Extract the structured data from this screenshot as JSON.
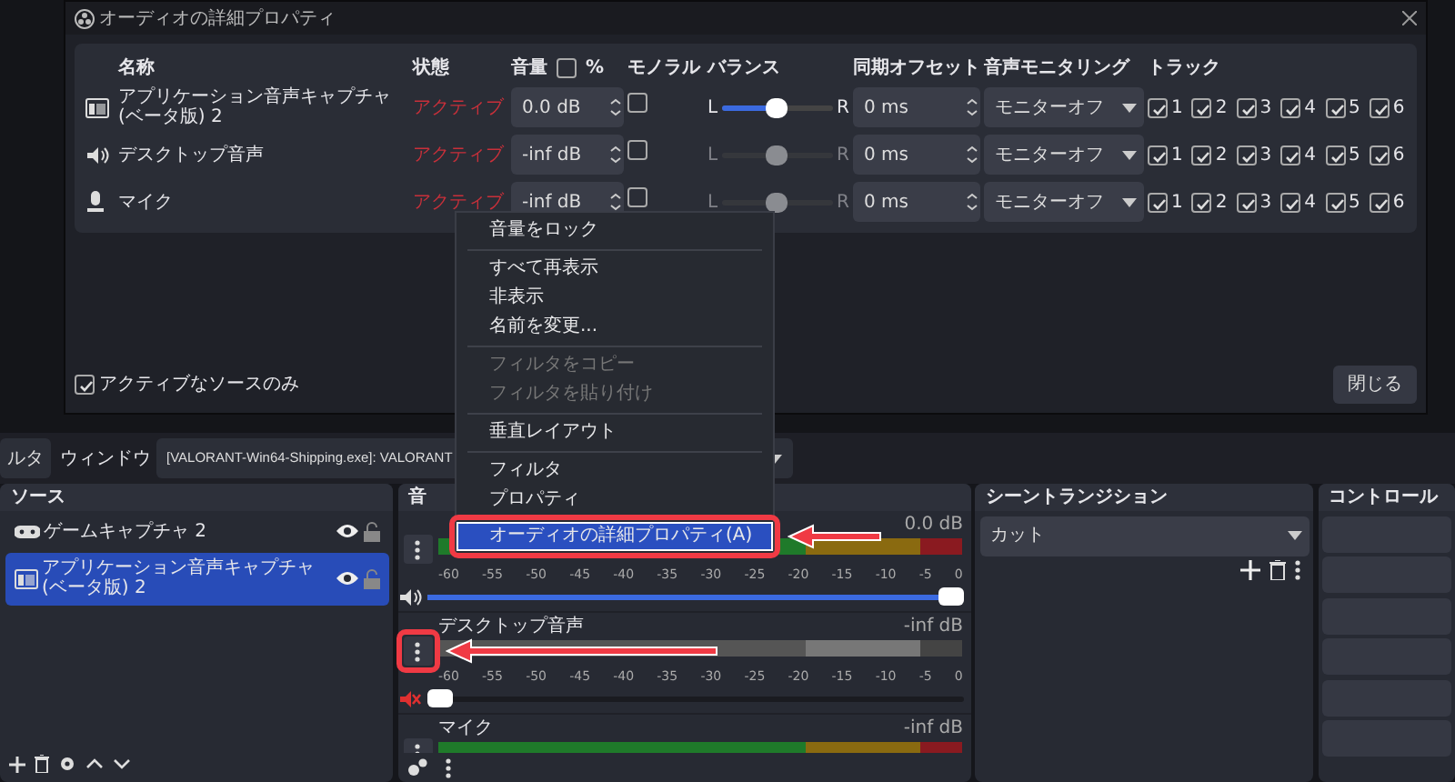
{
  "dialog": {
    "title": "オーディオの詳細プロパティ",
    "columns": [
      "名称",
      "状態",
      "音量",
      "モノラル",
      "バランス",
      "同期オフセット",
      "音声モニタリング",
      "トラック"
    ],
    "percent": {
      "label": "%",
      "checked": false
    },
    "rows": [
      {
        "kind": "app",
        "name": "アプリケーション音声キャプチャ (ベータ版) 2",
        "status": "アクティブ",
        "volume": "0.0 dB",
        "mono": false,
        "left": "L",
        "right": "R",
        "balance": {
          "level": 0.5,
          "disabled": false
        },
        "offset": "0 ms",
        "monitoring": "モニターオフ",
        "tracks": [
          {
            "label": "1",
            "checked": true
          },
          {
            "label": "2",
            "checked": true
          },
          {
            "label": "3",
            "checked": true
          },
          {
            "label": "4",
            "checked": true
          },
          {
            "label": "5",
            "checked": true
          },
          {
            "label": "6",
            "checked": true
          }
        ]
      },
      {
        "kind": "speaker",
        "name": "デスクトップ音声",
        "status": "アクティブ",
        "volume": "-inf dB",
        "mono": false,
        "left": "L",
        "right": "R",
        "balance": {
          "level": 0.5,
          "disabled": true
        },
        "offset": "0 ms",
        "monitoring": "モニターオフ",
        "tracks": [
          {
            "label": "1",
            "checked": true
          },
          {
            "label": "2",
            "checked": true
          },
          {
            "label": "3",
            "checked": true
          },
          {
            "label": "4",
            "checked": true
          },
          {
            "label": "5",
            "checked": true
          },
          {
            "label": "6",
            "checked": true
          }
        ]
      },
      {
        "kind": "mic",
        "name": "マイク",
        "status": "アクティブ",
        "volume": "-inf dB",
        "mono": false,
        "left": "L",
        "right": "R",
        "balance": {
          "level": 0.5,
          "disabled": true
        },
        "offset": "0 ms",
        "monitoring": "モニターオフ",
        "tracks": [
          {
            "label": "1",
            "checked": true
          },
          {
            "label": "2",
            "checked": true
          },
          {
            "label": "3",
            "checked": true
          },
          {
            "label": "4",
            "checked": true
          },
          {
            "label": "5",
            "checked": true
          },
          {
            "label": "6",
            "checked": true
          }
        ]
      }
    ],
    "active_only": {
      "label": "アクティブなソースのみ",
      "checked": true
    },
    "close_button": "閉じる"
  },
  "toolbar": {
    "filter_button": "ルタ",
    "window_label": "ウィンドウ",
    "window_value": "[VALORANT-Win64-Shipping.exe]: VALORANT"
  },
  "sources": {
    "title": "ソース",
    "items": [
      {
        "kind": "game",
        "name": "ゲームキャプチャ 2",
        "selected": false
      },
      {
        "kind": "app",
        "name": "アプリケーション音声キャプチャ (ベータ版) 2",
        "selected": true
      }
    ]
  },
  "mixer": {
    "title": "音",
    "items": [
      {
        "db": "0.0 dB",
        "muted": false,
        "scale": [
          "-60",
          "-55",
          "-50",
          "-45",
          "-40",
          "-35",
          "-30",
          "-25",
          "-20",
          "-15",
          "-10",
          "-5",
          "0"
        ],
        "level": 1
      },
      {
        "name": "デスクトップ音声",
        "db": "-inf dB",
        "muted": true,
        "scale": [
          "-60",
          "-55",
          "-50",
          "-45",
          "-40",
          "-35",
          "-30",
          "-25",
          "-20",
          "-15",
          "-10",
          "-5",
          "0"
        ],
        "level": 0
      },
      {
        "name": "マイク",
        "db": "-inf dB",
        "muted": false
      }
    ]
  },
  "transition": {
    "title": "シーントランジション",
    "value": "カット"
  },
  "controls": {
    "title": "コントロール"
  },
  "menu": {
    "items": [
      {
        "kind": "item",
        "label": "音量をロック",
        "disabled": false,
        "selected": false
      },
      {
        "kind": "separator"
      },
      {
        "kind": "item",
        "label": "すべて再表示",
        "disabled": false,
        "selected": false
      },
      {
        "kind": "item",
        "label": "非表示",
        "disabled": false,
        "selected": false
      },
      {
        "kind": "item",
        "label": "名前を変更...",
        "disabled": false,
        "selected": false
      },
      {
        "kind": "separator"
      },
      {
        "kind": "item",
        "label": "フィルタをコピー",
        "disabled": true,
        "selected": false
      },
      {
        "kind": "item",
        "label": "フィルタを貼り付け",
        "disabled": true,
        "selected": false
      },
      {
        "kind": "separator"
      },
      {
        "kind": "item",
        "label": "垂直レイアウト",
        "disabled": false,
        "selected": false
      },
      {
        "kind": "separator"
      },
      {
        "kind": "item",
        "label": "フィルタ",
        "disabled": false,
        "selected": false
      },
      {
        "kind": "item",
        "label": "プロパティ",
        "disabled": false,
        "selected": false
      },
      {
        "kind": "item",
        "label": "オーディオの詳細プロパティ(A)",
        "disabled": false,
        "selected": true
      }
    ]
  }
}
